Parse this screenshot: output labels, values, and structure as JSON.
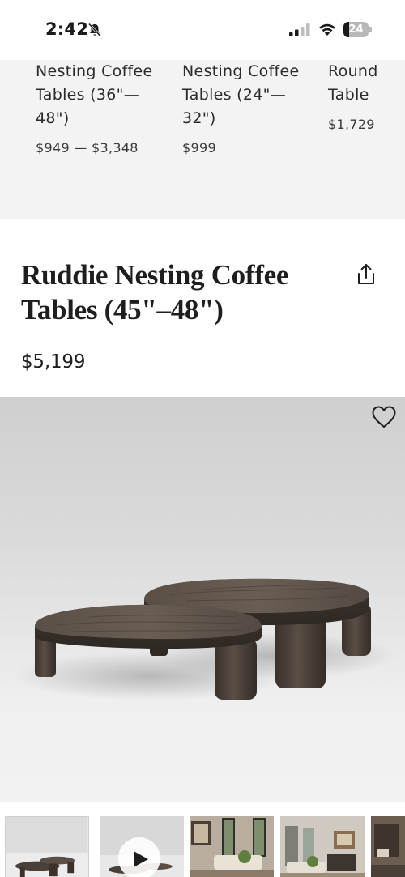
{
  "status_bar": {
    "time": "2:42",
    "battery": "24",
    "battery_level_percent": 24
  },
  "related_products": [
    {
      "name": "Nesting Coffee\nTables (36\"—\n48\")",
      "price": "$949 — $3,348"
    },
    {
      "name": "Nesting Coffee\nTables (24\"—\n32\")",
      "price": "$999"
    },
    {
      "name": "Round\nTable",
      "price": "$1,729"
    }
  ],
  "product": {
    "title": "Ruddie Nesting Coffee Tables (45\"–48\")",
    "price": "$5,199"
  },
  "icons": {
    "share": "share-icon",
    "favorite": "heart-icon",
    "play": "play-icon"
  },
  "colors": {
    "related_background": "#f3f3f3",
    "wood_dark": "#4a4038",
    "text": "#1e1e1e"
  },
  "thumbnails": [
    {
      "kind": "product-image",
      "selected": true
    },
    {
      "kind": "video",
      "selected": false
    },
    {
      "kind": "room-scene",
      "selected": false
    },
    {
      "kind": "room-scene",
      "selected": false
    },
    {
      "kind": "detail",
      "selected": false
    }
  ]
}
